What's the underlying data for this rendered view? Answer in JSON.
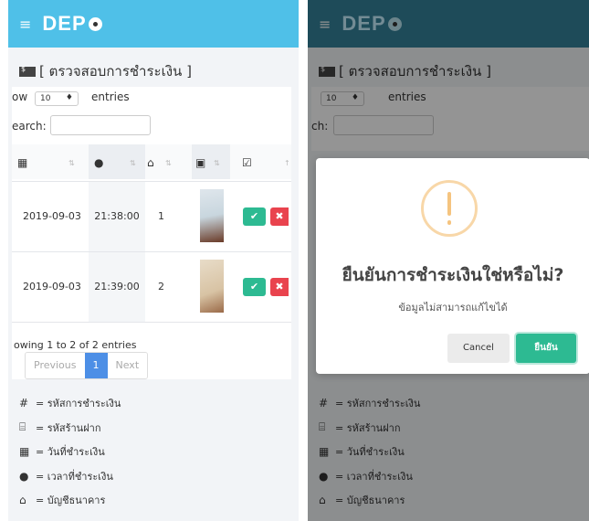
{
  "navbar": {
    "menu_icon": "hamburger-icon",
    "logo_text": "DEP"
  },
  "page": {
    "title": "[ ตรวจสอบการชำระเงิน ]",
    "title_icon": "money-bill-icon"
  },
  "controls": {
    "show_label": "ow",
    "show_value": "10",
    "entries_label": "entries",
    "search_label": "earch:",
    "search_value": "",
    "right_show_label": "",
    "right_search_label": "ch:"
  },
  "table": {
    "header_icons": [
      "calendar-icon",
      "clock-icon",
      "bank-icon",
      "image-icon",
      "checkbox-icon"
    ],
    "rows": [
      {
        "date": "2019-09-03",
        "time": "21:38:00",
        "account": "1",
        "approve_label": "✔",
        "reject_label": "✖"
      },
      {
        "date": "2019-09-03",
        "time": "21:39:00",
        "account": "2",
        "approve_label": "✔",
        "reject_label": "✖"
      }
    ],
    "info": "owing 1 to 2 of 2 entries",
    "pager": {
      "previous": "Previous",
      "current": "1",
      "next": "Next"
    }
  },
  "legend": [
    {
      "icon": "#",
      "text": "= รหัสการชำระเงิน"
    },
    {
      "icon": "store-icon",
      "text": "= รหัสร้านฝาก"
    },
    {
      "icon": "calendar-icon",
      "text": "= วันที่ชำระเงิน"
    },
    {
      "icon": "clock-icon",
      "text": "= เวลาที่ชำระเงิน"
    },
    {
      "icon": "bank-icon",
      "text": "= บัญชีธนาคาร"
    }
  ],
  "modal": {
    "icon": "warning-icon",
    "title": "ยืนยันการชำระเงินใช่หรือไม่?",
    "text": "ข้อมูลไม่สามารถแก้ไขได้",
    "cancel_label": "Cancel",
    "confirm_label": "ยืนยัน"
  },
  "colors": {
    "navbar": "#4fc0e8",
    "approve": "#2dba92",
    "reject": "#e9434e",
    "pager_active": "#4d8fe6"
  }
}
